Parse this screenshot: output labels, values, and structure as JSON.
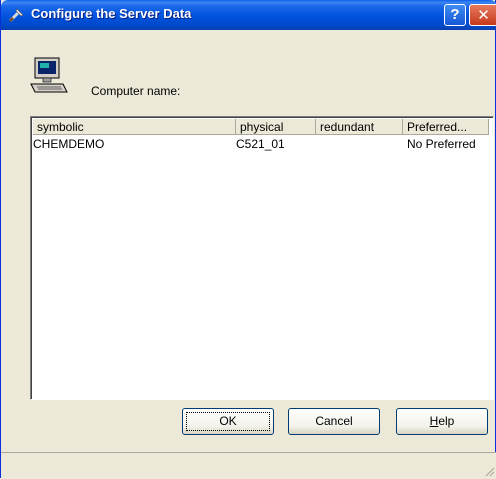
{
  "window": {
    "title": "Configure the Server Data",
    "help_glyph": "?",
    "close_glyph": "✕"
  },
  "computer_label": "Computer name:",
  "list": {
    "columns": [
      "symbolic",
      "physical",
      "redundant",
      "Preferred..."
    ],
    "rows": [
      [
        "CHEMDEMO",
        "C521_01",
        "",
        "No Preferred"
      ]
    ]
  },
  "buttons": {
    "ok": "OK",
    "cancel": "Cancel",
    "help_first": "H",
    "help_rest": "elp"
  },
  "colors": {
    "titlebar": "#0052dd",
    "dialog_bg": "#ece9d8",
    "close": "#c5391c"
  },
  "icons": {
    "title": "tools-icon",
    "computer": "computer-icon"
  }
}
